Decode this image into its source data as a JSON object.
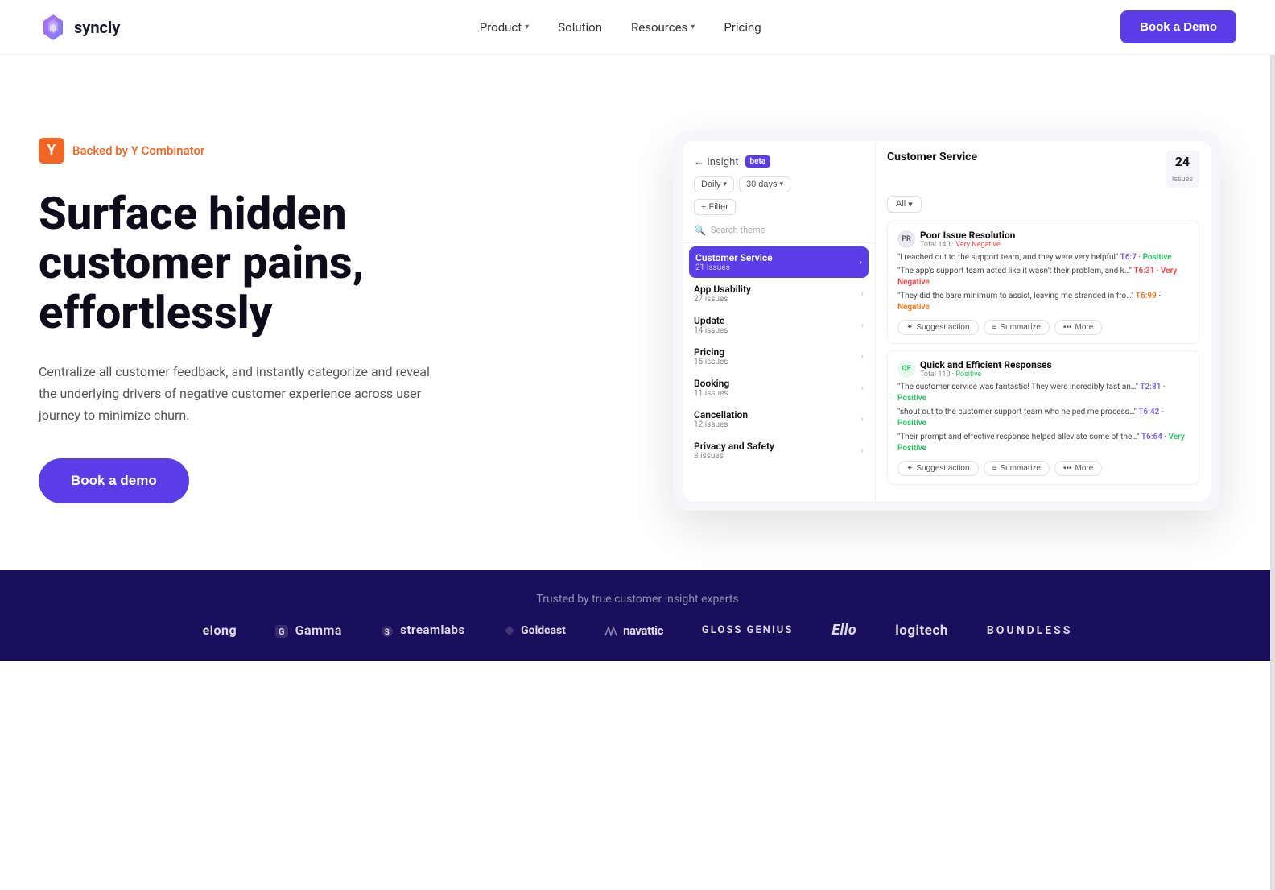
{
  "navbar": {
    "logo_text": "syncly",
    "links": [
      {
        "label": "Product",
        "has_dropdown": true
      },
      {
        "label": "Solution",
        "has_dropdown": false
      },
      {
        "label": "Resources",
        "has_dropdown": true
      },
      {
        "label": "Pricing",
        "has_dropdown": false
      }
    ],
    "cta_label": "Book a Demo"
  },
  "hero": {
    "yc_badge": "Backed by Y Combinator",
    "title": "Surface hidden customer pains, effortlessly",
    "subtitle": "Centralize all customer feedback, and instantly categorize and reveal the underlying drivers of negative customer experience across user journey to minimize churn.",
    "cta_label": "Book a demo"
  },
  "dashboard": {
    "back_label": "← Insight",
    "beta_label": "beta",
    "filter_daily": "Daily",
    "filter_30days": "30 days",
    "filter_btn": "+ Filter",
    "search_placeholder": "Search theme",
    "items": [
      {
        "name": "Customer Service",
        "count": "21 Issues",
        "active": true
      },
      {
        "name": "App Usability",
        "count": "27 issues"
      },
      {
        "name": "Update",
        "count": "14 issues"
      },
      {
        "name": "Pricing",
        "count": "15 issues"
      },
      {
        "name": "Booking",
        "count": "11 issues"
      },
      {
        "name": "Cancellation",
        "count": "12 issues"
      },
      {
        "name": "Privacy and Safety",
        "count": "8 issues"
      }
    ],
    "right_title": "Customer Service",
    "right_count": "24",
    "right_count_label": "Issues",
    "filter_all": "All",
    "issues": [
      {
        "avatar": "PR",
        "title": "Poor Issue Resolution",
        "meta_total": "Total 140",
        "meta_sentiment": "Very Negative",
        "sentiment_type": "negative",
        "quotes": [
          {
            "text": "\"I reached out to the support team, and they were very helpful\"",
            "score": "T6:7",
            "sentiment": "Positive",
            "sentiment_type": "positive"
          },
          {
            "text": "\"The app's support team acted like it wasn't their problem, and k…\"",
            "score": "T6:31",
            "sentiment": "Very Negative",
            "sentiment_type": "negative"
          },
          {
            "text": "\"They did the bare minimum to assist, leaving me stranded in fro…\"",
            "score": "T6:99",
            "sentiment": "Negative",
            "sentiment_type": "negative"
          }
        ],
        "actions": [
          "Suggest action",
          "Summarize",
          "More"
        ]
      },
      {
        "avatar": "QE",
        "title": "Quick and Efficient Responses",
        "meta_total": "Total 110",
        "meta_sentiment": "Positive",
        "sentiment_type": "positive",
        "quotes": [
          {
            "text": "\"The customer service was fantastic! They were incredibly fast an…\"",
            "score": "T2:81",
            "sentiment": "Positive",
            "sentiment_type": "positive"
          },
          {
            "text": "\"shout out to the customer support team who helped me process…\"",
            "score": "T6:42",
            "sentiment": "Positive",
            "sentiment_type": "positive"
          },
          {
            "text": "\"Their prompt and effective response helped alleviate some of the…\"",
            "score": "T6:64",
            "sentiment": "Very Positive",
            "sentiment_type": "positive"
          }
        ],
        "actions": [
          "Suggest action",
          "Summarize",
          "More"
        ]
      }
    ]
  },
  "trusted": {
    "label": "Trusted by true customer insight experts",
    "logos": [
      {
        "name": "belong",
        "display": "elong",
        "prefix": ""
      },
      {
        "name": "gamma",
        "display": "Gamma"
      },
      {
        "name": "streamlabs",
        "display": "streamlabs"
      },
      {
        "name": "goldcast",
        "display": "Goldcast"
      },
      {
        "name": "navattic",
        "display": "navattic"
      },
      {
        "name": "glossgenius",
        "display": "GLOSS GENIUS"
      },
      {
        "name": "ello",
        "display": "Ello"
      },
      {
        "name": "logitech",
        "display": "logitech"
      },
      {
        "name": "boundless",
        "display": "BOUNDLESS"
      }
    ]
  }
}
